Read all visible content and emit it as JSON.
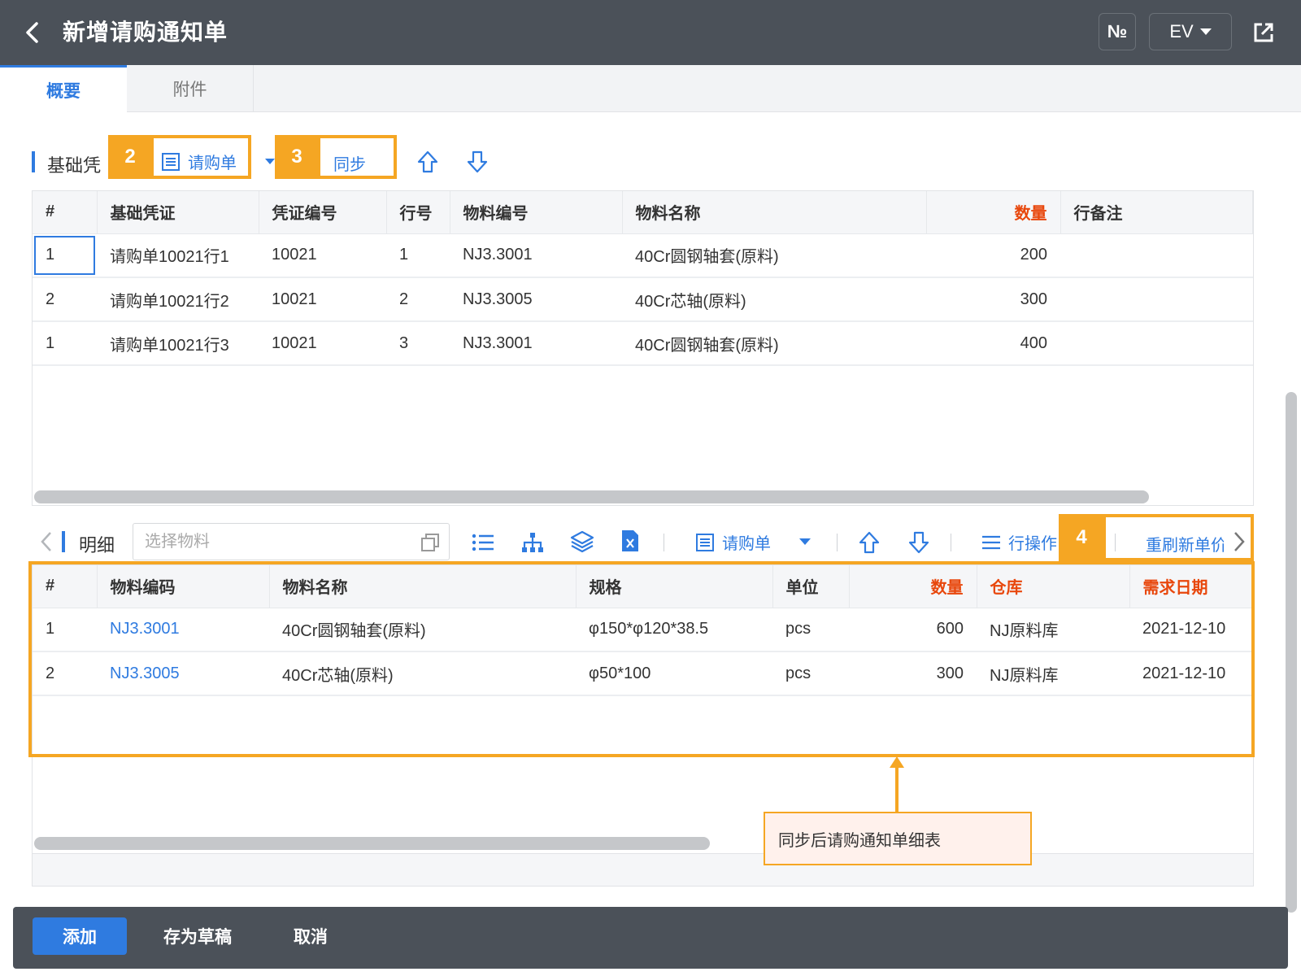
{
  "header": {
    "title": "新增请购通知单",
    "number_button": "№",
    "lang_button": "EV"
  },
  "tabs": [
    "概要",
    "附件"
  ],
  "section1": {
    "title": "基础凭",
    "toolbar": {
      "purchase_req": "请购单",
      "sync": "同步"
    },
    "callouts": [
      "2",
      "3"
    ],
    "columns": [
      "#",
      "基础凭证",
      "凭证编号",
      "行号",
      "物料编号",
      "物料名称",
      "数量",
      "行备注"
    ],
    "rows": [
      [
        "1",
        "请购单10021行1",
        "10021",
        "1",
        "NJ3.3001",
        "40Cr圆钢轴套(原料)",
        "200",
        ""
      ],
      [
        "2",
        "请购单10021行2",
        "10021",
        "2",
        "NJ3.3005",
        "40Cr芯轴(原料)",
        "300",
        ""
      ],
      [
        "1",
        "请购单10021行3",
        "10021",
        "3",
        "NJ3.3001",
        "40Cr圆钢轴套(原料)",
        "400",
        ""
      ]
    ]
  },
  "section2": {
    "title": "明细",
    "search_placeholder": "选择物料",
    "toolbar": {
      "purchase_req": "请购单",
      "row_ops": "行操作",
      "refresh_price": "重刷新单价"
    },
    "callout": "4",
    "columns": [
      "#",
      "物料编码",
      "物料名称",
      "规格",
      "单位",
      "数量",
      "仓库",
      "需求日期"
    ],
    "rows": [
      [
        "1",
        "NJ3.3001",
        "40Cr圆钢轴套(原料)",
        "φ150*φ120*38.5",
        "pcs",
        "600",
        "NJ原料库",
        "2021-12-10"
      ],
      [
        "2",
        "NJ3.3005",
        "40Cr芯轴(原料)",
        "φ50*100",
        "pcs",
        "300",
        "NJ原料库",
        "2021-12-10"
      ]
    ]
  },
  "annotation": "同步后请购通知单细表",
  "footer": {
    "add": "添加",
    "save_draft": "存为草稿",
    "cancel": "取消"
  },
  "colors": {
    "header_bg": "#4b5159",
    "accent": "#2f7be0",
    "callout": "#f5a623",
    "required": "#e8470c"
  }
}
